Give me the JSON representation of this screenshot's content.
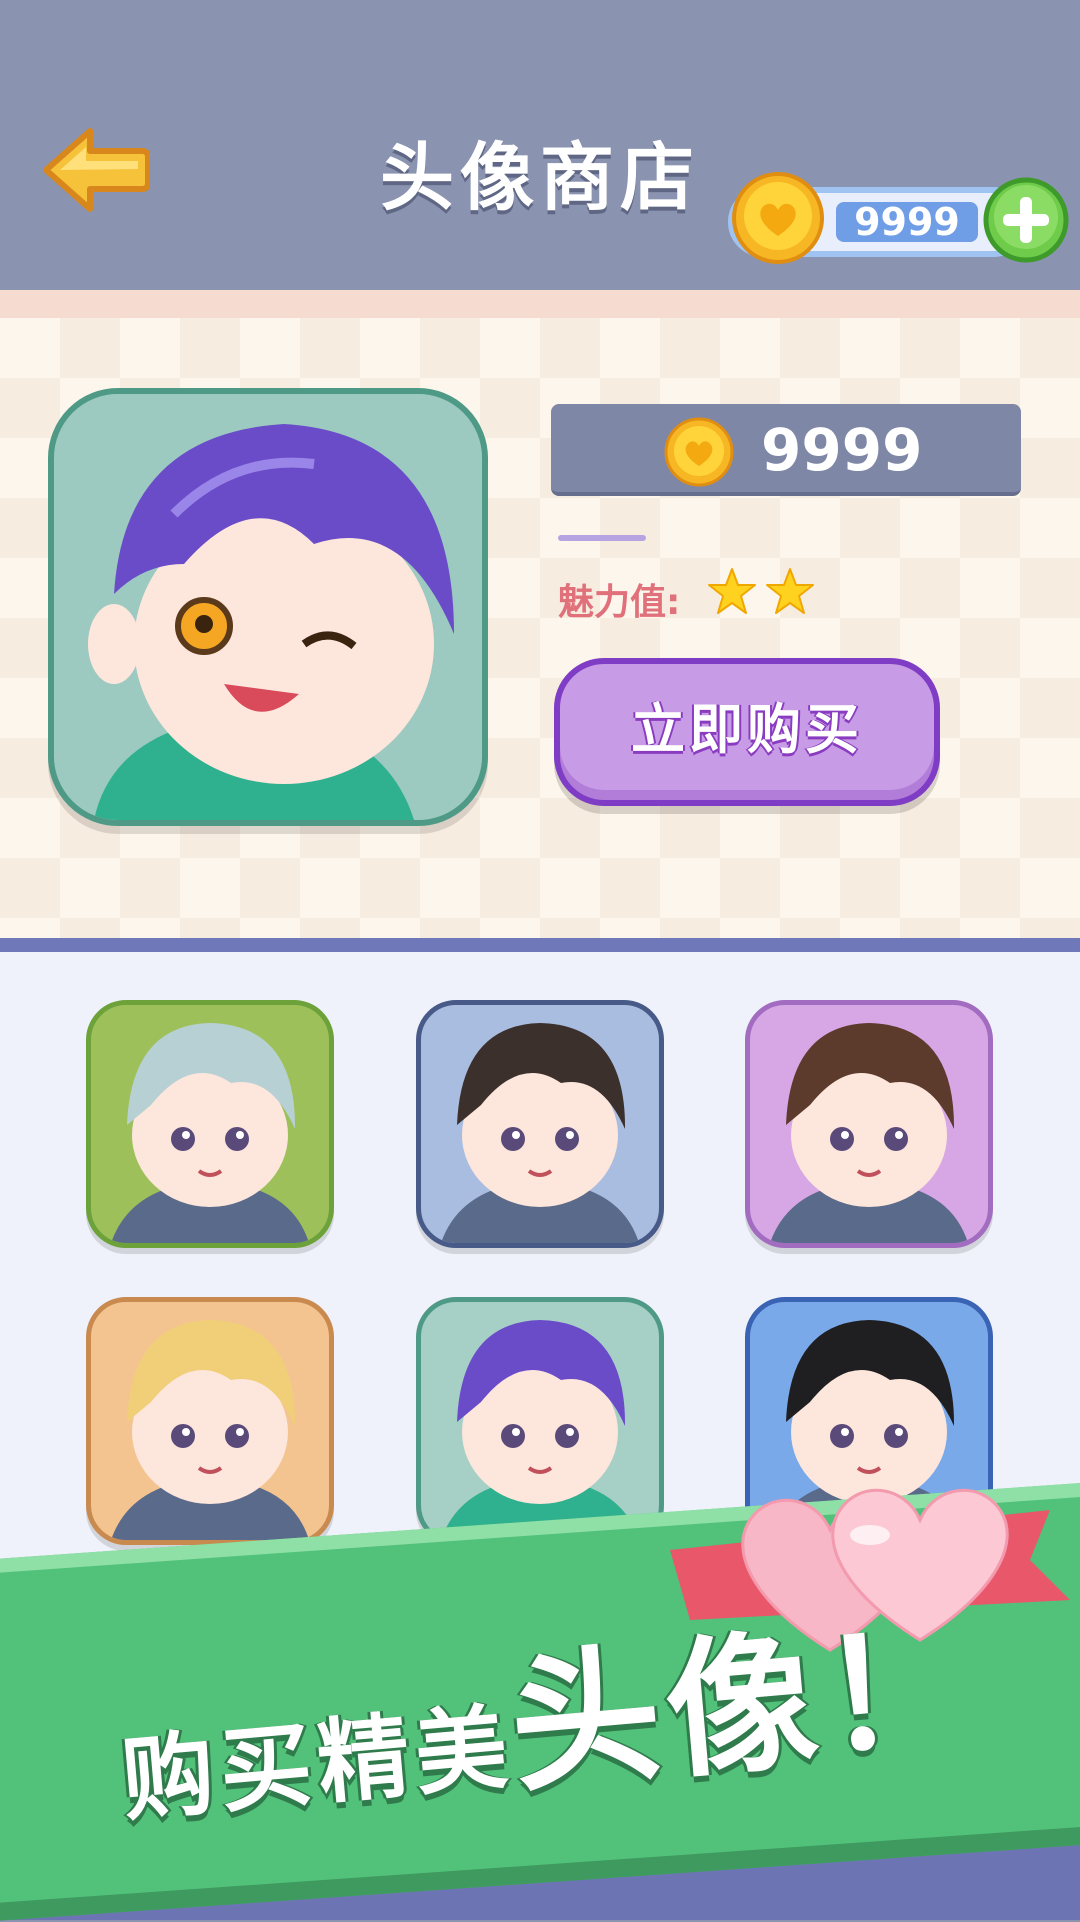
{
  "header": {
    "title": "头像商店",
    "coins": "9999"
  },
  "featured": {
    "price": "9999",
    "charm_label": "魅力值:",
    "charm_stars": 2,
    "buy_label": "立即购买"
  },
  "avatars": [
    {
      "name": "silver-hair-glasses",
      "bg": "#9ec05a",
      "border": "#6da23a"
    },
    {
      "name": "dark-hair-blue",
      "bg": "#a9bde0",
      "border": "#475a88"
    },
    {
      "name": "brown-hair-glasses",
      "bg": "#d7a6e4",
      "border": "#a26cc0"
    },
    {
      "name": "blonde-hair",
      "bg": "#f4c490",
      "border": "#c98a4f"
    },
    {
      "name": "purple-hair-wink",
      "bg": "#a6cfc6",
      "border": "#4f9a86"
    },
    {
      "name": "black-hair",
      "bg": "#7aa9ea",
      "border": "#3a63b4"
    }
  ],
  "banner": {
    "text_small": "购买精美",
    "text_big": "头像！"
  },
  "colors": {
    "header_bg": "#8a93b0",
    "buy_button": "#c79be6",
    "banner_green": "#52c17a"
  }
}
